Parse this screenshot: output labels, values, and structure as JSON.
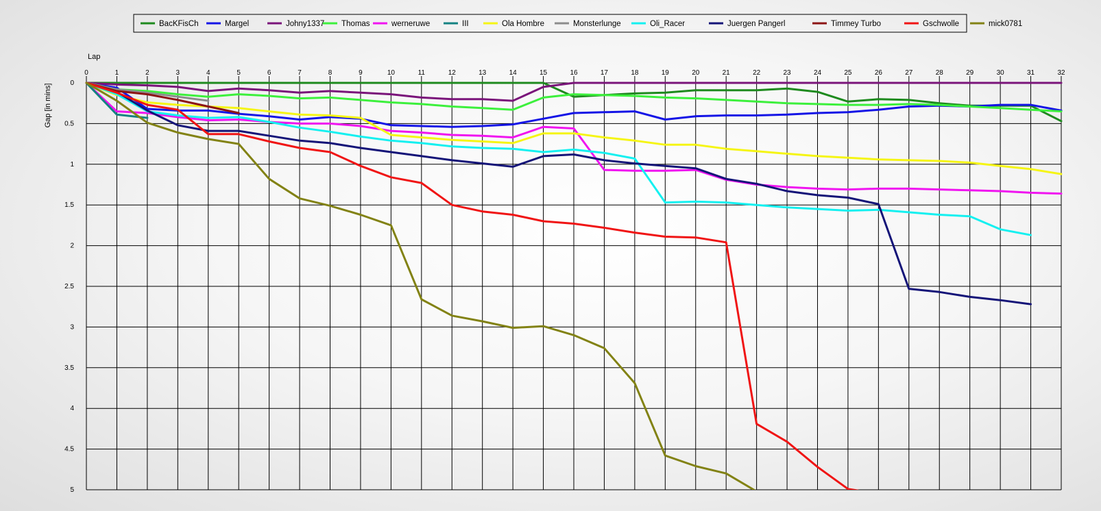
{
  "chart_data": {
    "type": "line",
    "xlabel": "Lap",
    "ylabel": "Gap [in mins]",
    "xlim": [
      0,
      32
    ],
    "ylim": [
      0,
      5
    ],
    "y_inverted": true,
    "grid": true,
    "legend_position": "top-center",
    "x_ticks": [
      "0",
      "1",
      "2",
      "3",
      "4",
      "5",
      "6",
      "7",
      "8",
      "9",
      "10",
      "11",
      "12",
      "13",
      "14",
      "15",
      "16",
      "17",
      "18",
      "19",
      "20",
      "21",
      "22",
      "23",
      "24",
      "25",
      "26",
      "27",
      "28",
      "29",
      "30",
      "31",
      "32"
    ],
    "y_ticks": [
      "0",
      "0.5",
      "1",
      "1.5",
      "2",
      "2.5",
      "3",
      "3.5",
      "4",
      "4.5",
      "5"
    ],
    "series": [
      {
        "name": "BacKFisCh",
        "color": "#1e8a1e",
        "x": [
          0,
          1,
          2,
          3,
          4,
          5,
          6,
          7,
          8,
          9,
          10,
          11,
          12,
          13,
          14,
          15,
          16,
          17,
          18,
          19,
          20,
          21,
          22,
          23,
          24,
          25,
          26,
          27,
          28,
          29,
          30,
          31,
          32
        ],
        "values": [
          0,
          0,
          0,
          0,
          0,
          0,
          0,
          0,
          0,
          0,
          0,
          0,
          0,
          0,
          0,
          0,
          0.17,
          0.15,
          0.13,
          0.12,
          0.09,
          0.09,
          0.09,
          0.07,
          0.11,
          0.23,
          0.2,
          0.21,
          0.25,
          0.28,
          0.28,
          0.28,
          0.47
        ]
      },
      {
        "name": "Margel",
        "color": "#1414e6",
        "x": [
          0,
          1,
          2,
          3,
          4,
          5,
          6,
          7,
          8,
          9,
          10,
          11,
          12,
          13,
          14,
          15,
          16,
          17,
          18,
          19,
          20,
          21,
          22,
          23,
          24,
          25,
          26,
          27,
          28,
          29,
          30,
          31,
          32
        ],
        "values": [
          0,
          0.06,
          0.32,
          0.34,
          0.34,
          0.38,
          0.41,
          0.45,
          0.42,
          0.44,
          0.52,
          0.53,
          0.54,
          0.53,
          0.51,
          0.44,
          0.37,
          0.36,
          0.35,
          0.45,
          0.41,
          0.4,
          0.4,
          0.39,
          0.37,
          0.36,
          0.33,
          0.29,
          0.28,
          0.29,
          0.27,
          0.27,
          0.34
        ]
      },
      {
        "name": "Johny1337",
        "color": "#7a147a",
        "x": [
          0,
          1,
          2,
          3,
          4,
          5,
          6,
          7,
          8,
          9,
          10,
          11,
          12,
          13,
          14,
          15,
          16,
          17,
          18,
          19,
          20,
          21,
          22,
          23,
          24,
          25,
          26,
          27,
          28,
          29,
          30,
          31,
          32
        ],
        "values": [
          0,
          0.02,
          0.03,
          0.05,
          0.1,
          0.07,
          0.09,
          0.12,
          0.1,
          0.12,
          0.14,
          0.18,
          0.2,
          0.2,
          0.22,
          0.05,
          0,
          0,
          0,
          0,
          0,
          0,
          0,
          0,
          0,
          0,
          0,
          0,
          0,
          0,
          0,
          0,
          0
        ]
      },
      {
        "name": "Thomas",
        "color": "#3cf03c",
        "x": [
          0,
          1,
          2,
          3,
          4,
          5,
          6,
          7,
          8,
          9,
          10,
          11,
          12,
          13,
          14,
          15,
          16,
          17,
          18,
          19,
          20,
          21,
          22,
          23,
          24,
          25,
          26,
          27,
          28,
          29,
          30,
          31,
          32
        ],
        "values": [
          0,
          0.08,
          0.1,
          0.14,
          0.17,
          0.14,
          0.16,
          0.19,
          0.18,
          0.21,
          0.24,
          0.26,
          0.29,
          0.31,
          0.33,
          0.18,
          0.14,
          0.15,
          0.16,
          0.18,
          0.19,
          0.21,
          0.23,
          0.25,
          0.26,
          0.27,
          0.27,
          0.26,
          0.27,
          0.29,
          0.31,
          0.33,
          0.35
        ]
      },
      {
        "name": "werneruwe",
        "color": "#f014f0",
        "x": [
          0,
          1,
          2,
          3,
          4,
          5,
          6,
          7,
          8,
          9,
          10,
          11,
          12,
          13,
          14,
          15,
          16,
          17,
          18,
          19,
          20,
          21,
          22,
          23,
          24,
          25,
          26,
          27,
          28,
          29,
          30,
          31,
          32
        ],
        "values": [
          0,
          0.35,
          0.37,
          0.42,
          0.46,
          0.45,
          0.48,
          0.5,
          0.5,
          0.53,
          0.59,
          0.61,
          0.64,
          0.65,
          0.67,
          0.54,
          0.56,
          1.07,
          1.08,
          1.08,
          1.07,
          1.19,
          1.25,
          1.28,
          1.3,
          1.31,
          1.3,
          1.3,
          1.31,
          1.32,
          1.33,
          1.35,
          1.36
        ]
      },
      {
        "name": "III",
        "color": "#148282",
        "x": [
          0,
          1,
          2
        ],
        "values": [
          0,
          0.39,
          0.43
        ]
      },
      {
        "name": "Ola Hombre",
        "color": "#f5f514",
        "x": [
          0,
          1,
          2,
          3,
          4,
          5,
          6,
          7,
          8,
          9,
          10,
          11,
          12,
          13,
          14,
          15,
          16,
          17,
          18,
          19,
          20,
          21,
          22,
          23,
          24,
          25,
          26,
          27,
          28,
          29,
          30,
          31,
          32
        ],
        "values": [
          0,
          0.15,
          0.24,
          0.27,
          0.29,
          0.31,
          0.35,
          0.39,
          0.4,
          0.43,
          0.64,
          0.67,
          0.7,
          0.72,
          0.74,
          0.62,
          0.62,
          0.67,
          0.71,
          0.76,
          0.76,
          0.81,
          0.84,
          0.87,
          0.9,
          0.92,
          0.94,
          0.95,
          0.96,
          0.98,
          1.02,
          1.06,
          1.12
        ]
      },
      {
        "name": "Monsterlunge",
        "color": "#8c8c8c",
        "x": [
          0,
          1,
          2,
          3,
          4
        ],
        "values": [
          0,
          0.08,
          0.12,
          0.17,
          0.22
        ]
      },
      {
        "name": "Oli_Racer",
        "color": "#14f0f0",
        "x": [
          0,
          1,
          2,
          3,
          4,
          5,
          6,
          7,
          8,
          9,
          10,
          11,
          12,
          13,
          14,
          15,
          16,
          17,
          18,
          19,
          20,
          21,
          22,
          23,
          24,
          25,
          26,
          27,
          28,
          29,
          30,
          31
        ],
        "values": [
          0,
          0.14,
          0.35,
          0.4,
          0.43,
          0.42,
          0.48,
          0.55,
          0.6,
          0.66,
          0.71,
          0.74,
          0.78,
          0.8,
          0.81,
          0.85,
          0.82,
          0.86,
          0.93,
          1.47,
          1.46,
          1.47,
          1.5,
          1.53,
          1.55,
          1.57,
          1.56,
          1.59,
          1.62,
          1.64,
          1.8,
          1.87
        ]
      },
      {
        "name": "Juergen Pangerl",
        "color": "#141478",
        "x": [
          0,
          1,
          2,
          3,
          4,
          5,
          6,
          7,
          8,
          9,
          10,
          11,
          12,
          13,
          14,
          15,
          16,
          17,
          18,
          19,
          20,
          21,
          22,
          23,
          24,
          25,
          26,
          27,
          28,
          29,
          30,
          31
        ],
        "values": [
          0,
          0.11,
          0.34,
          0.52,
          0.59,
          0.59,
          0.65,
          0.71,
          0.74,
          0.8,
          0.85,
          0.9,
          0.95,
          0.99,
          1.03,
          0.9,
          0.88,
          0.95,
          0.99,
          1.02,
          1.05,
          1.18,
          1.24,
          1.33,
          1.38,
          1.41,
          1.49,
          2.53,
          2.57,
          2.63,
          2.67,
          2.72
        ]
      },
      {
        "name": "Timmey Turbo",
        "color": "#8c1414",
        "x": [
          0,
          1,
          2,
          3,
          4,
          5
        ],
        "values": [
          0,
          0.1,
          0.14,
          0.21,
          0.29,
          0.37
        ]
      },
      {
        "name": "Gschwolle",
        "color": "#f01414",
        "x": [
          0,
          1,
          2,
          3,
          4,
          5,
          6,
          7,
          8,
          9,
          10,
          11,
          12,
          13,
          14,
          15,
          16,
          17,
          18,
          19,
          20,
          21,
          22,
          23,
          24,
          25,
          26
        ],
        "values": [
          0,
          0.12,
          0.27,
          0.33,
          0.63,
          0.63,
          0.72,
          0.8,
          0.85,
          1.02,
          1.16,
          1.23,
          1.5,
          1.58,
          1.62,
          1.7,
          1.73,
          1.78,
          1.84,
          1.89,
          1.9,
          1.96,
          4.19,
          4.41,
          4.72,
          4.99,
          5.05
        ]
      },
      {
        "name": "mick0781",
        "color": "#828214",
        "x": [
          0,
          1,
          2,
          3,
          4,
          5,
          6,
          7,
          8,
          9,
          10,
          11,
          12,
          13,
          14,
          15,
          16,
          17,
          18,
          19,
          20,
          21,
          22
        ],
        "values": [
          0,
          0.22,
          0.49,
          0.61,
          0.69,
          0.75,
          1.18,
          1.42,
          1.51,
          1.62,
          1.75,
          2.66,
          2.86,
          2.93,
          3.01,
          2.99,
          3.1,
          3.26,
          3.69,
          4.58,
          4.71,
          4.8,
          5.02
        ]
      }
    ]
  }
}
